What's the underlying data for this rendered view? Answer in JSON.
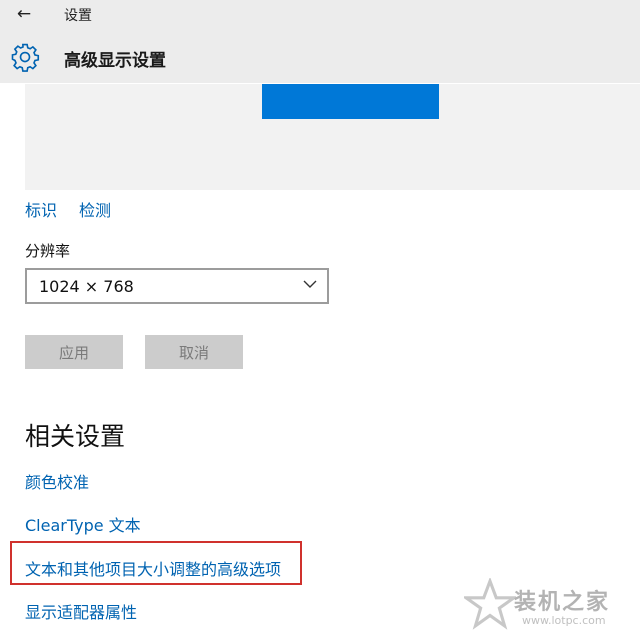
{
  "window": {
    "title": "设置",
    "back_icon": "arrow-left-icon"
  },
  "header": {
    "title": "高级显示设置",
    "icon": "gear-icon"
  },
  "display": {
    "monitor_color": "#0078d7"
  },
  "links": {
    "identify": "标识",
    "detect": "检测"
  },
  "resolution": {
    "label": "分辨率",
    "value": "1024 × 768"
  },
  "buttons": {
    "apply": "应用",
    "cancel": "取消"
  },
  "related": {
    "title": "相关设置",
    "links": [
      "颜色校准",
      "ClearType 文本",
      "文本和其他项目大小调整的高级选项",
      "显示适配器属性"
    ]
  },
  "highlight_color": "#d0312d",
  "watermark": {
    "text": "装机之家",
    "url": "www.lotpc.com"
  }
}
